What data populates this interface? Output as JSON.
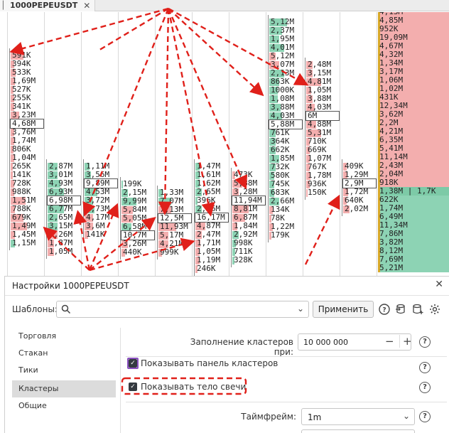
{
  "tab": {
    "title": "1000PEPEUSDT",
    "close": "✕"
  },
  "chart": {
    "columns": [
      {
        "cells": [
          [
            "591K",
            0.4,
            "r"
          ],
          [
            "394K",
            0.1,
            "r"
          ],
          [
            "533K",
            0.15,
            "r"
          ],
          [
            "1,69M",
            0.12,
            "r"
          ],
          [
            "527K",
            0.08,
            "r"
          ],
          [
            "255K",
            0.1,
            "r"
          ],
          [
            "341K",
            0.1,
            "r"
          ],
          [
            "3,23M",
            0.25,
            "r"
          ],
          [
            "4,68M",
            0.0,
            "p"
          ],
          [
            "3,76M",
            0.1,
            "r"
          ],
          [
            "1,74M",
            0.1,
            "r"
          ],
          [
            "806K",
            0.08,
            "r"
          ],
          [
            "1,04M",
            0.1,
            "r"
          ],
          [
            "265K",
            0.06,
            "r"
          ],
          [
            "141K",
            0.06,
            "r"
          ],
          [
            "728K",
            0.1,
            "r"
          ],
          [
            "988K",
            0.1,
            "r"
          ],
          [
            "1,51M",
            0.45,
            "r"
          ],
          [
            "788K",
            0.12,
            "r"
          ],
          [
            "679K",
            0.4,
            "r"
          ],
          [
            "1,49M",
            0.5,
            "r"
          ],
          [
            "1,45M",
            0.12,
            "r"
          ],
          [
            "1,15M",
            0.12,
            "g"
          ]
        ]
      },
      {
        "cells": [
          [
            "2,87M",
            0.3,
            "g"
          ],
          [
            "3,01M",
            0.3,
            "g"
          ],
          [
            "4,93M",
            0.4,
            "g"
          ],
          [
            "6,93M",
            0.5,
            "g"
          ],
          [
            "6,98M",
            0.0,
            "p"
          ],
          [
            "6,77M",
            0.5,
            "g"
          ],
          [
            "2,65M",
            0.3,
            "g"
          ],
          [
            "3,15M",
            0.3,
            "g"
          ],
          [
            "5,26M",
            0.3,
            "r"
          ],
          [
            "1,87M",
            0.2,
            "r"
          ],
          [
            "1,05M",
            0.2,
            "r"
          ]
        ]
      },
      {
        "cells": [
          [
            "1,11M",
            0.15,
            "g"
          ],
          [
            "3,56M",
            0.2,
            "g"
          ],
          [
            "9,89M",
            0.0,
            "p"
          ],
          [
            "4,53M",
            0.4,
            "g"
          ],
          [
            "3,72M",
            0.25,
            "g"
          ],
          [
            "2,73M",
            0.3,
            "g"
          ],
          [
            "4,17M",
            0.25,
            "r"
          ],
          [
            "3,6M",
            0.25,
            "r"
          ],
          [
            "141K",
            0.1,
            "r"
          ]
        ]
      },
      {
        "cells": [
          [
            "199K",
            0.05,
            "g"
          ],
          [
            "2,15M",
            0.2,
            "g"
          ],
          [
            "9,99M",
            0.45,
            "g"
          ],
          [
            "5,84M",
            0.35,
            "r"
          ],
          [
            "5,05M",
            0.35,
            "r"
          ],
          [
            "6,58M",
            0.3,
            "g"
          ],
          [
            "10,7M",
            0.0,
            "p"
          ],
          [
            "3,26M",
            0.2,
            "r"
          ],
          [
            "440K",
            0.1,
            "r"
          ]
        ]
      },
      {
        "cells": [
          [
            "1,33M",
            0.12,
            "g"
          ],
          [
            "7,07M",
            0.4,
            "g"
          ],
          [
            "7,13M",
            0.4,
            "r"
          ],
          [
            "12,5M",
            0.0,
            "p"
          ],
          [
            "11,93M",
            0.55,
            "r"
          ],
          [
            "5,17M",
            0.3,
            "r"
          ],
          [
            "4,21M",
            0.3,
            "r"
          ],
          [
            "999K",
            0.1,
            "r"
          ]
        ]
      },
      {
        "cells": [
          [
            "1,47M",
            0.12,
            "g"
          ],
          [
            "1,61M",
            0.12,
            "g"
          ],
          [
            "1,62M",
            0.12,
            "g"
          ],
          [
            "2,65M",
            0.2,
            "g"
          ],
          [
            "396K",
            0.06,
            "g"
          ],
          [
            "2,36M",
            0.2,
            "g"
          ],
          [
            "16,17M",
            0.0,
            "p"
          ],
          [
            "4,87M",
            0.3,
            "r"
          ],
          [
            "2,47M",
            0.2,
            "r"
          ],
          [
            "1,71M",
            0.15,
            "r"
          ],
          [
            "1,05M",
            0.12,
            "r"
          ],
          [
            "1,19M",
            0.12,
            "r"
          ],
          [
            "246K",
            0.06,
            "r"
          ]
        ]
      },
      {
        "cells": [
          [
            "473K",
            0.08,
            "r"
          ],
          [
            "5,88M",
            0.3,
            "r"
          ],
          [
            "3,28M",
            0.2,
            "r"
          ],
          [
            "11,94M",
            0.0,
            "p"
          ],
          [
            "8,81M",
            0.5,
            "r"
          ],
          [
            "6,87M",
            0.4,
            "r"
          ],
          [
            "1,84M",
            0.15,
            "r"
          ],
          [
            "2,92M",
            0.2,
            "g"
          ],
          [
            "998K",
            0.1,
            "g"
          ],
          [
            "711K",
            0.08,
            "g"
          ],
          [
            "328K",
            0.06,
            "g"
          ]
        ]
      },
      {
        "cells": [
          [
            "5,12M",
            0.55,
            "g"
          ],
          [
            "2,37M",
            0.4,
            "g"
          ],
          [
            "1,95M",
            0.3,
            "g"
          ],
          [
            "4,01M",
            0.45,
            "g"
          ],
          [
            "5,12M",
            0.2,
            "r"
          ],
          [
            "3,07M",
            0.3,
            "r"
          ],
          [
            "2,13M",
            0.45,
            "g"
          ],
          [
            "863K",
            0.3,
            "g"
          ],
          [
            "1000K",
            0.25,
            "g"
          ],
          [
            "1,08M",
            0.25,
            "g"
          ],
          [
            "3,88M",
            0.35,
            "g"
          ],
          [
            "4,03M",
            0.4,
            "g"
          ],
          [
            "5,88M",
            0.0,
            "p"
          ],
          [
            "761K",
            0.2,
            "g"
          ],
          [
            "364K",
            0.2,
            "g"
          ],
          [
            "662K",
            0.2,
            "g"
          ],
          [
            "1,85M",
            0.3,
            "g"
          ],
          [
            "732K",
            0.2,
            "g"
          ],
          [
            "580K",
            0.15,
            "g"
          ],
          [
            "745K",
            0.15,
            "g"
          ],
          [
            "683K",
            0.15,
            "g"
          ],
          [
            "2,66M",
            0.3,
            "g"
          ],
          [
            "134K",
            0.1,
            "r"
          ],
          [
            "78K",
            0.06,
            "r"
          ],
          [
            "1,22M",
            0.1,
            "r"
          ],
          [
            "179K",
            0.06,
            "r"
          ]
        ]
      },
      {
        "cells": [
          [
            "2,48M",
            0.2,
            "r"
          ],
          [
            "3,15M",
            0.2,
            "r"
          ],
          [
            "4,81M",
            0.45,
            "r"
          ],
          [
            "1,05M",
            0.15,
            "r"
          ],
          [
            "3,88M",
            0.2,
            "r"
          ],
          [
            "4,03M",
            0.25,
            "r"
          ],
          [
            "6M",
            0.0,
            "p"
          ],
          [
            "4,88M",
            0.3,
            "r"
          ],
          [
            "5,31M",
            0.45,
            "r"
          ],
          [
            "710K",
            0.1,
            "r"
          ],
          [
            "669K",
            0.1,
            "r"
          ],
          [
            "1,07M",
            0.1,
            "r"
          ],
          [
            "767K",
            0.1,
            "r"
          ],
          [
            "1,78M",
            0.12,
            "r"
          ],
          [
            "936K",
            0.1,
            "r"
          ],
          [
            "150K",
            0.05,
            "r"
          ]
        ]
      },
      {
        "cells": [
          [
            "409K",
            0.1,
            "r"
          ],
          [
            "1,29M",
            0.12,
            "r"
          ],
          [
            "2,9M",
            0.0,
            "p"
          ],
          [
            "1,72M",
            0.15,
            "r"
          ],
          [
            "640K",
            0.1,
            "r"
          ],
          [
            "2,02M",
            0.2,
            "r"
          ]
        ]
      },
      {
        "cells": [
          [
            "4,13M",
            0,
            "r"
          ],
          [
            "4,85M",
            0,
            "r"
          ],
          [
            "952K",
            0,
            "r"
          ],
          [
            "19,09M",
            0,
            "r"
          ],
          [
            "4,67M",
            0,
            "r"
          ],
          [
            "4,32M",
            0,
            "r"
          ],
          [
            "1,34M",
            0,
            "r"
          ],
          [
            "3,17M",
            0,
            "r"
          ],
          [
            "1,06M",
            0,
            "r"
          ],
          [
            "1,02M",
            0,
            "r"
          ],
          [
            "431K",
            0,
            "r"
          ],
          [
            "12,34M",
            0,
            "r"
          ],
          [
            "3,62M",
            0,
            "r"
          ],
          [
            "2,2M",
            0,
            "r"
          ],
          [
            "4,21M",
            0,
            "r"
          ],
          [
            "6,35M",
            0,
            "r"
          ],
          [
            "5,41M",
            0,
            "r"
          ],
          [
            "11,14M",
            0,
            "r"
          ],
          [
            "2,43M",
            0,
            "r"
          ],
          [
            "2,04M",
            0,
            "r"
          ],
          [
            "918K",
            0,
            "r"
          ],
          [
            "1,38M | 1,7K",
            0,
            "x"
          ],
          [
            "622K",
            0,
            "g"
          ],
          [
            "1,74M",
            0,
            "g"
          ],
          [
            "6,49M",
            0,
            "g"
          ],
          [
            "11,34M",
            0,
            "g"
          ],
          [
            "7,86M",
            0,
            "g"
          ],
          [
            "3,82M",
            0,
            "g"
          ],
          [
            "8,12M",
            0,
            "g"
          ],
          [
            "7,69M",
            0,
            "g"
          ],
          [
            "5,21M",
            0,
            "g"
          ]
        ]
      }
    ]
  },
  "dialog": {
    "title": "Настройки 1000PEPEUSDT",
    "templates_label": "Шаблоны:",
    "templates_value": "",
    "apply_label": "Применить",
    "sidebar": [
      "Торговля",
      "Стакан",
      "Тики",
      "Кластеры",
      "Общие"
    ],
    "active_sidebar_index": 3,
    "fill_label": "Заполнение кластеров при:",
    "fill_value": "10 000 000",
    "minus": "−",
    "plus": "+",
    "show_panel_label": "Показывать панель кластеров",
    "show_body_label": "Показывать тело свечи",
    "timeframe_label": "Таймфрейм:",
    "timeframe_value": "1m",
    "help": "?"
  },
  "colors": {
    "green": "#8dd3b4",
    "red": "#f3aeae",
    "gold": "#d8a92a",
    "annot": "#e0201a"
  }
}
